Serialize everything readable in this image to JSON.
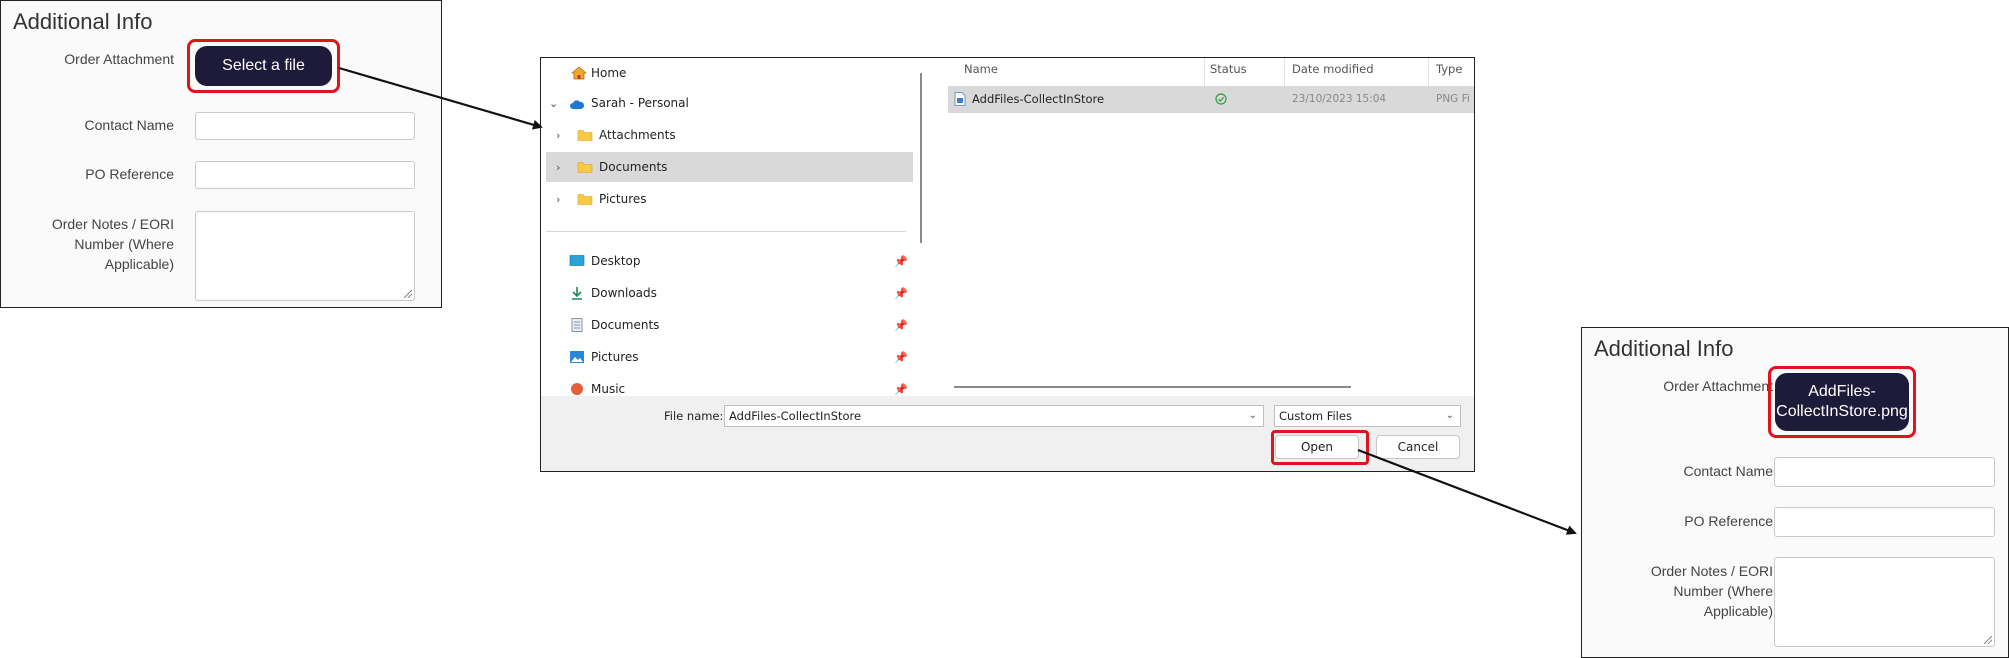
{
  "left_form": {
    "title": "Additional Info",
    "order_attachment_label": "Order Attachment",
    "select_button": "Select a file",
    "contact_name_label": "Contact Name",
    "po_reference_label": "PO Reference",
    "order_notes_label_1": "Order Notes / EORI",
    "order_notes_label_2": "Number (Where",
    "order_notes_label_3": "Applicable)"
  },
  "dialog": {
    "nav": {
      "home": "Home",
      "personal": "Sarah - Personal",
      "attachments": "Attachments",
      "documents": "Documents",
      "pictures": "Pictures",
      "quick": [
        "Desktop",
        "Downloads",
        "Documents",
        "Pictures",
        "Music"
      ]
    },
    "columns": {
      "name": "Name",
      "status": "Status",
      "date_modified": "Date modified",
      "type": "Type"
    },
    "file": {
      "name": "AddFiles-CollectInStore",
      "date": "23/10/2023 15:04",
      "type": "PNG Fi"
    },
    "file_name_label": "File name:",
    "file_name_value": "AddFiles-CollectInStore",
    "file_type_value": "Custom Files",
    "open_button": "Open",
    "cancel_button": "Cancel"
  },
  "right_form": {
    "title": "Additional Info",
    "order_attachment_label": "Order Attachment",
    "file_button_line1": "AddFiles-",
    "file_button_line2": "CollectInStore.png",
    "contact_name_label": "Contact Name",
    "po_reference_label": "PO Reference",
    "order_notes_label_1": "Order Notes / EORI",
    "order_notes_label_2": "Number (Where",
    "order_notes_label_3": "Applicable)"
  },
  "colors": {
    "highlight": "#e0141c",
    "button": "#1e1b3a",
    "selected_row": "#d9d9d9"
  }
}
